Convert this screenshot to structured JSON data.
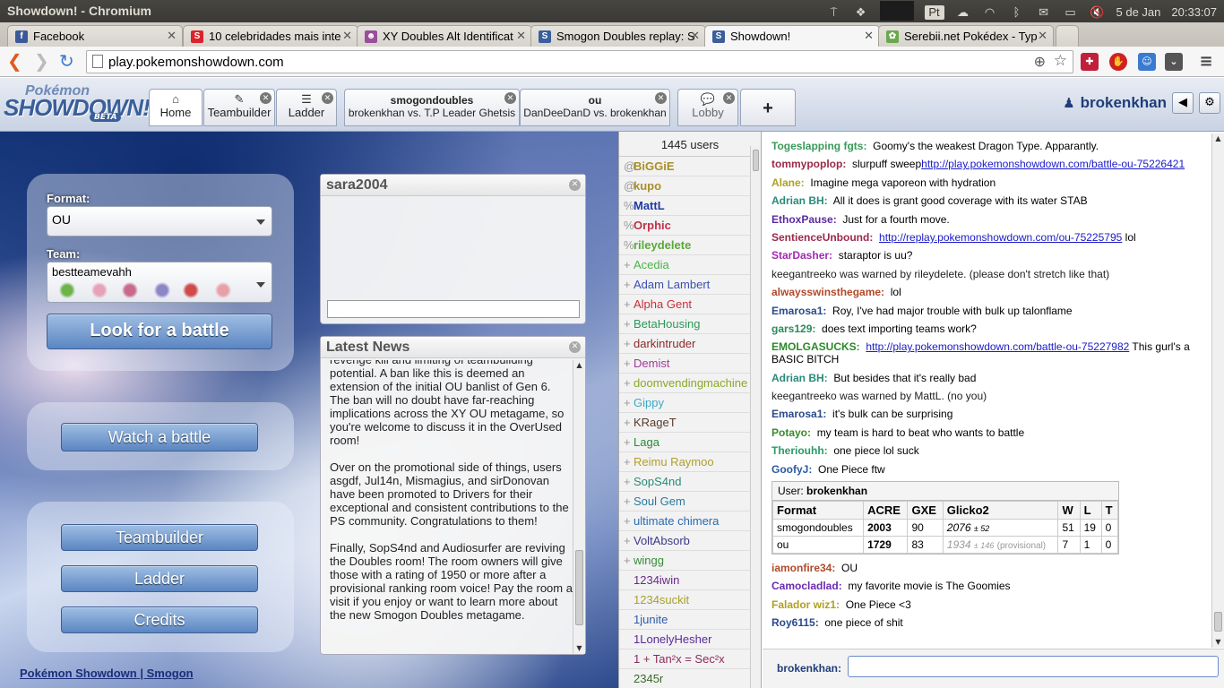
{
  "os": {
    "title": "Showdown! - Chromium",
    "lang": "Pt",
    "date": "5 de Jan",
    "time": "20:33:07"
  },
  "browser": {
    "tabs": [
      {
        "label": "Facebook",
        "fav": "f",
        "color": "#3b5998"
      },
      {
        "label": "10 celebridades mais inte",
        "fav": "S",
        "color": "#d9232d"
      },
      {
        "label": "XY Doubles Alt Identificat",
        "fav": "☻",
        "color": "#9b4e9b"
      },
      {
        "label": "Smogon Doubles replay: S",
        "fav": "S",
        "color": "#3a5f9a"
      },
      {
        "label": "Showdown!",
        "fav": "S",
        "color": "#3a5f9a"
      },
      {
        "label": "Serebii.net Pokédex - Typ",
        "fav": "✿",
        "color": "#6aa84f"
      }
    ],
    "url": "play.pokemonshowdown.com"
  },
  "header": {
    "logo_top": "Pokémon",
    "logo_main": "SHOWDOWN!",
    "logo_beta": "BETA",
    "tabs": {
      "home": "Home",
      "teambuilder": "Teambuilder",
      "ladder": "Ladder",
      "lobby": "Lobby",
      "add": "+"
    },
    "rooms": [
      {
        "format": "smogondoubles",
        "match": "brokenkhan vs. T.P Leader Ghetsis"
      },
      {
        "format": "ou",
        "match": "DanDeeDanD vs. brokenkhan"
      }
    ],
    "username": "brokenkhan"
  },
  "main": {
    "format_label": "Format:",
    "format_value": "OU",
    "team_label": "Team:",
    "team_name": "bestteamevahh",
    "look_button": "Look for a battle",
    "watch_button": "Watch a battle",
    "teambuilder_button": "Teambuilder",
    "ladder_button": "Ladder",
    "credits_button": "Credits",
    "footer_1": "Pokémon Showdown",
    "footer_sep": " | ",
    "footer_2": "Smogon"
  },
  "pm": {
    "title": "sara2004"
  },
  "news": {
    "title": "Latest News",
    "paragraphs": [
      "revenge kill and limiting of teambuilding potential. A ban like this is deemed an extension of the initial OU banlist of Gen 6. The ban will no doubt have far-reaching implications across the XY OU metagame, so you're welcome to discuss it in the OverUsed room!",
      "Over on the promotional side of things, users asgdf, Jul14n, Mismagius, and sirDonovan have been promoted to Drivers for their exceptional and consistent contributions to the PS community. Congratulations to them!",
      "Finally, SopS4nd and Audiosurfer are reviving the Doubles room! The room owners will give those with a rating of 1950 or more after a provisional ranking room voice! Pay the room a visit if you enjoy or want to learn more about the new Smogon Doubles metagame."
    ]
  },
  "userlist": {
    "count": "1445 users",
    "users": [
      {
        "g": "@",
        "name": "BiGGiE",
        "color": "#a8902a",
        "bold": true
      },
      {
        "g": "@",
        "name": "kupo",
        "color": "#a8902a",
        "bold": true
      },
      {
        "g": "%",
        "name": "MattL",
        "color": "#1e3aa8",
        "bold": true
      },
      {
        "g": "%",
        "name": "Orphic",
        "color": "#c0304a",
        "bold": true
      },
      {
        "g": "%",
        "name": "rileydelete",
        "color": "#5aa83a",
        "bold": true
      },
      {
        "g": "+",
        "name": "Acedia",
        "color": "#4ab34a",
        "bold": false
      },
      {
        "g": "+",
        "name": "Adam Lambert",
        "color": "#3a4fb0",
        "bold": false
      },
      {
        "g": "+",
        "name": "Alpha Gent",
        "color": "#c8303a",
        "bold": false
      },
      {
        "g": "+",
        "name": "BetaHousing",
        "color": "#2a9a5a",
        "bold": false
      },
      {
        "g": "+",
        "name": "darkintruder",
        "color": "#8a2a2a",
        "bold": false
      },
      {
        "g": "+",
        "name": "Demist",
        "color": "#a03a9a",
        "bold": false
      },
      {
        "g": "+",
        "name": "doomvendingmachine",
        "color": "#8aa82a",
        "bold": false
      },
      {
        "g": "+",
        "name": "Gippy",
        "color": "#3aa8c8",
        "bold": false
      },
      {
        "g": "+",
        "name": "KRageT",
        "color": "#5a3a2a",
        "bold": false
      },
      {
        "g": "+",
        "name": "Laga",
        "color": "#2a8a3a",
        "bold": false
      },
      {
        "g": "+",
        "name": "Reimu Raymoo",
        "color": "#b0a02a",
        "bold": false
      },
      {
        "g": "+",
        "name": "SopS4nd",
        "color": "#2a8a7a",
        "bold": false
      },
      {
        "g": "+",
        "name": "Soul Gem",
        "color": "#2a7aa0",
        "bold": false
      },
      {
        "g": "+",
        "name": "ultimate chimera",
        "color": "#2a6ab0",
        "bold": false
      },
      {
        "g": "+",
        "name": "VoltAbsorb",
        "color": "#3a3a8a",
        "bold": false
      },
      {
        "g": "+",
        "name": "wingg",
        "color": "#3a8a3a",
        "bold": false
      },
      {
        "g": "",
        "name": "1234iwin",
        "color": "#6a2a8a",
        "bold": false
      },
      {
        "g": "",
        "name": "1234suckit",
        "color": "#a8a02a",
        "bold": false
      },
      {
        "g": "",
        "name": "1junite",
        "color": "#2a5ab0",
        "bold": false
      },
      {
        "g": "",
        "name": "1LonelyHesher",
        "color": "#5a2a9a",
        "bold": false
      },
      {
        "g": "",
        "name": "1 + Tan²x = Sec²x",
        "color": "#8a2a5a",
        "bold": false
      },
      {
        "g": "",
        "name": "2345r",
        "color": "#3a6a2a",
        "bold": false
      }
    ]
  },
  "chat": {
    "messages": [
      {
        "user": "Togeslapping fgts:",
        "color": "#3a9a5a",
        "text": "Goomy's the weakest Dragon Type. Apparantly.",
        "link": ""
      },
      {
        "user": "tommypoplop:",
        "color": "#9a2a4a",
        "text": "slurpuff sweep",
        "link": "http://play.pokemonshowdown.com/battle-ou-75226421"
      },
      {
        "user": "Alane:",
        "color": "#b0a020",
        "text": "Imagine mega vaporeon with hydration",
        "link": ""
      },
      {
        "user": "Adrian BH:",
        "color": "#2a8a7a",
        "text": "All it does is grant good coverage with its water STAB",
        "link": ""
      },
      {
        "user": "EthoxPause:",
        "color": "#5a2aa0",
        "text": "Just for a fourth move.",
        "link": ""
      },
      {
        "user": "SentienceUnbound:",
        "color": "#9a2a4a",
        "text": "",
        "link": "http://replay.pokemonshowdown.com/ou-75225795",
        "after": " lol"
      },
      {
        "user": "StarDasher:",
        "color": "#a02ab0",
        "text": "staraptor is uu?",
        "link": ""
      },
      {
        "user": "",
        "color": "#222",
        "text": "keegantreeko was warned by rileydelete. (please don't stretch like that)",
        "link": ""
      },
      {
        "user": "alwaysswinsthegame:",
        "color": "#b04a2a",
        "text": "lol",
        "link": ""
      },
      {
        "user": "Emarosa1:",
        "color": "#2a4a8a",
        "text": "Roy, I've had major trouble with bulk up talonflame",
        "link": ""
      },
      {
        "user": "gars129:",
        "color": "#2a8a5a",
        "text": "does text importing teams work?",
        "link": ""
      },
      {
        "user": "EMOLGASUCKS:",
        "color": "#2a8a2a",
        "text": "",
        "link": "http://play.pokemonshowdown.com/battle-ou-75227982",
        "after": " This gurl's a BASIC BITCH"
      },
      {
        "user": "Adrian BH:",
        "color": "#2a8a7a",
        "text": "But besides that it's really bad",
        "link": ""
      },
      {
        "user": "",
        "color": "#222",
        "text": "keegantreeko was warned by MattL. (no you)",
        "link": ""
      },
      {
        "user": "Emarosa1:",
        "color": "#2a4a8a",
        "text": "it's bulk can be surprising",
        "link": ""
      },
      {
        "user": "Potayo:",
        "color": "#3a8a2a",
        "text": "my team is hard to beat who wants to battle",
        "link": ""
      },
      {
        "user": "Theriouhh:",
        "color": "#2a9a6a",
        "text": "one piece lol suck",
        "link": ""
      },
      {
        "user": "GoofyJ:",
        "color": "#2a5aa0",
        "text": "One Piece ftw",
        "link": ""
      }
    ],
    "rank": {
      "user_label": "User:",
      "user": "brokenkhan",
      "headers": [
        "Format",
        "ACRE",
        "GXE",
        "Glicko2",
        "W",
        "L",
        "T"
      ],
      "rows": [
        [
          "smogondoubles",
          "2003",
          "90",
          "2076",
          "± 52",
          "",
          "51",
          "19",
          "0"
        ],
        [
          "ou",
          "1729",
          "83",
          "1934",
          "± 146",
          "(provisional)",
          "7",
          "1",
          "0"
        ]
      ]
    },
    "messages2": [
      {
        "user": "iamonfire34:",
        "color": "#b04a2a",
        "text": "OU",
        "link": ""
      },
      {
        "user": "Camocladlad:",
        "color": "#6a2ab0",
        "text": "my favorite movie is The Goomies",
        "link": ""
      },
      {
        "user": "Falador wiz1:",
        "color": "#b0a020",
        "text": "One Piece <3",
        "link": ""
      },
      {
        "user": "Roy6115:",
        "color": "#2a4a8a",
        "text": "one piece of shit",
        "link": ""
      }
    ],
    "input_name": "brokenkhan:"
  }
}
